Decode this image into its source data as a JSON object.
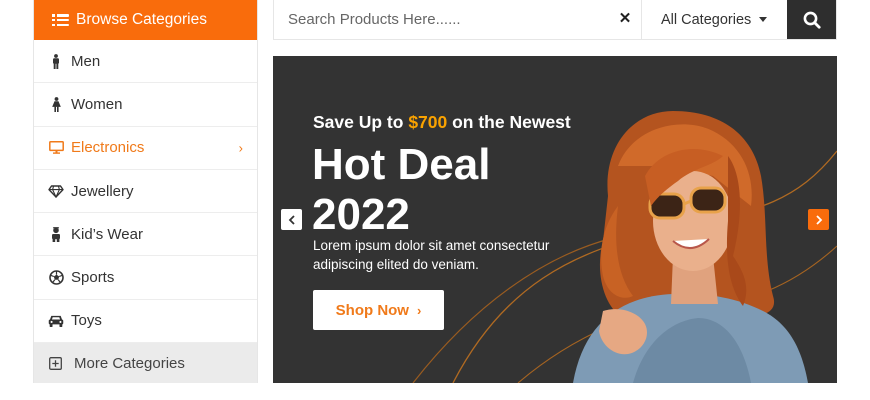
{
  "sidebar": {
    "title": "Browse Categories",
    "items": [
      {
        "label": "Men",
        "icon": "man-icon",
        "active": false
      },
      {
        "label": "Women",
        "icon": "woman-icon",
        "active": false
      },
      {
        "label": "Electronics",
        "icon": "monitor-icon",
        "active": true
      },
      {
        "label": "Jewellery",
        "icon": "diamond-icon",
        "active": false
      },
      {
        "label": "Kid’s Wear",
        "icon": "child-icon",
        "active": false
      },
      {
        "label": "Sports",
        "icon": "soccer-ball-icon",
        "active": false
      },
      {
        "label": "Toys",
        "icon": "toy-car-icon",
        "active": false
      }
    ],
    "more_label": "More Categories"
  },
  "search": {
    "placeholder": "Search Products Here......",
    "value": "",
    "category": "All Categories"
  },
  "banner": {
    "kicker_prefix": "Save Up to ",
    "kicker_amount": "$700",
    "kicker_suffix": " on the Newest",
    "headline_line1": "Hot Deal",
    "headline_line2": "2022",
    "description": "Lorem ipsum dolor sit amet consectetur adipiscing elited do veniam.",
    "cta_label": "Shop Now"
  },
  "colors": {
    "accent": "#f96c0c",
    "highlight": "#f9a200",
    "banner_bg": "#333333",
    "search_button_bg": "#2e2e2e"
  }
}
